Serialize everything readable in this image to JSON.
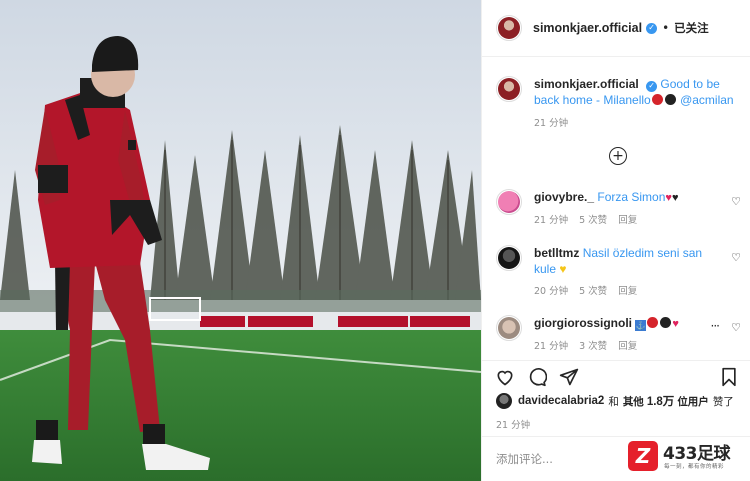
{
  "post": {
    "username": "simonkjaer.official",
    "follow_status": "已关注",
    "caption": {
      "username": "simonkjaer.official",
      "text": "Good to be back home - Milanello",
      "mention": "@acmilan",
      "time": "21 分钟"
    }
  },
  "comments": [
    {
      "username": "giovybre._",
      "text": "Forza Simon",
      "time": "21 分钟",
      "likes": "5 次赞",
      "reply": "回复"
    },
    {
      "username": "betlltmz",
      "text": "Nasil özledim seni san kule",
      "time": "20 分钟",
      "likes": "5 次赞",
      "reply": "回复"
    },
    {
      "username": "giorgiorossignoli",
      "text": "",
      "time": "21 分钟",
      "likes": "3 次赞",
      "reply": "回复"
    }
  ],
  "likes": {
    "first_user": "davidecalabria2",
    "joiner": "和",
    "others_prefix": "其他",
    "others_count": "1.8万",
    "others_suffix": "位用户",
    "action": "赞了"
  },
  "post_time": "21 分钟",
  "add_comment": {
    "placeholder": "添加评论..."
  },
  "watermark": {
    "logo_letter": "Z",
    "name": "433足球",
    "tagline": "每一刻，都有你的精彩"
  },
  "icons": [
    "heart-icon",
    "comment-icon",
    "share-icon",
    "bookmark-icon",
    "plus-circle-icon",
    "verified-icon",
    "more-icon"
  ],
  "colors": {
    "link": "#3897f0",
    "milan_red": "#b3102b",
    "meta_gray": "#8e8e8e",
    "watermark_red": "#e5202b"
  }
}
